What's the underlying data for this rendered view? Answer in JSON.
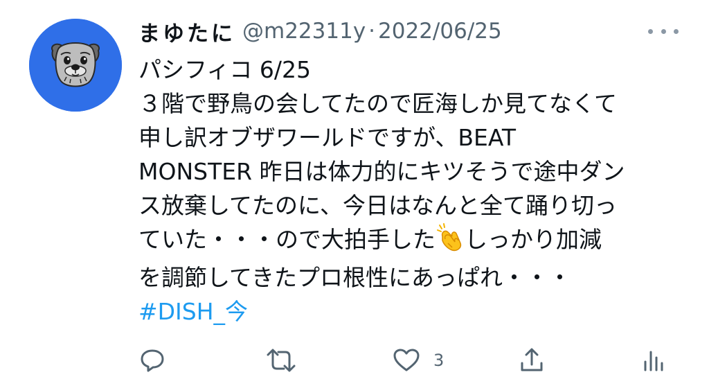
{
  "tweet": {
    "display_name": "まゆたに",
    "handle": "@m22311y",
    "separator": "·",
    "date": "2022/06/25",
    "lines": [
      "パシフィコ 6/25",
      "３階で野鳥の会してたので匠海しか見てなくて",
      "申し訳オブザワールドですが、BEAT",
      "MONSTER 昨日は体力的にキツそうで途中ダン",
      "ス放棄してたのに、今日はなんと全て踊り切っ"
    ],
    "line6_before_emoji": "ていた・・・ので大拍手した",
    "line6_after_emoji": "しっかり加減",
    "line7": "を調節してきたプロ根性にあっぱれ・・・",
    "hashtag": "#DISH_今",
    "like_count": "3"
  },
  "icons": {
    "more": "more-horizontal-icon",
    "reply": "reply-icon",
    "retweet": "retweet-icon",
    "like": "heart-icon",
    "share": "share-icon",
    "analytics": "analytics-icon",
    "emoji": "clapping-hands-icon"
  },
  "colors": {
    "avatar_bg": "#2f6fe8",
    "text": "#0f1419",
    "secondary": "#536471",
    "link": "#1d9bf0",
    "icon": "#536471"
  }
}
